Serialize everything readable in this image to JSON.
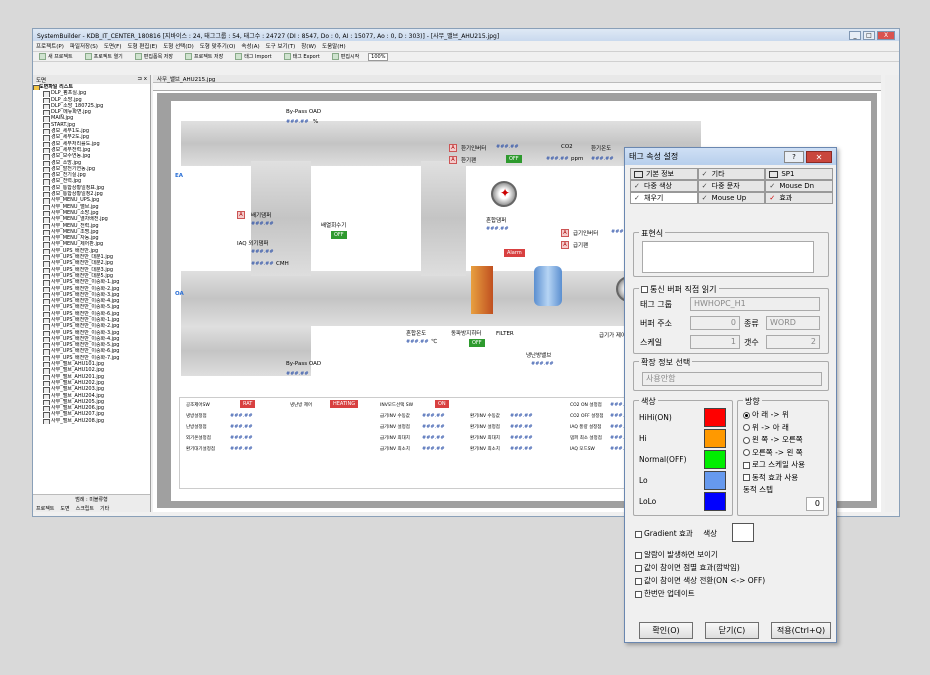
{
  "window": {
    "title": "SystemBuilder - KDB_IT_CENTER_180816 [지바이스 : 24, 태그그룹 : 54, 태그수 : 24727 (DI : 8547, Do : 0, AI : 15077, Ao : 0, D : 303)] - [사무_밸브_AHU215.jpg]",
    "min": "_",
    "max": "□",
    "close": "X"
  },
  "menu": [
    "프로젝트(P)",
    "파일저장(S)",
    "도면(F)",
    "도형 편집(E)",
    "도형 선택(D)",
    "도형 맞추기(O)",
    "속성(A)",
    "도구 보기(T)",
    "창(W)",
    "도움말(H)"
  ],
  "toolbar": [
    "새 프로젝트",
    "프로젝트 열기",
    "편집폼목 저장",
    "프로젝트 저장",
    "태그 Import",
    "태그 Export",
    "편집시작"
  ],
  "zoom": "100%",
  "tree": {
    "header": "도면",
    "pin": "⊐ x",
    "root": "도면파일 리스트",
    "items": [
      "DLP_펌프실.jpg",
      "DLP_소방.jpg",
      "DLP_소방_180725.jpg",
      "DLP_메뉴화면.jpg",
      "MAIN.jpg",
      "START.jpg",
      "경보_세부1도.jpg",
      "경보_세부2도.jpg",
      "경보_세부처리률도.jpg",
      "경보_세부전력.jpg",
      "경보_보수연동.jpg",
      "경보_소방.jpg",
      "경보_발전기연동.jpg",
      "경보_전기실.jpg",
      "경보_전력.jpg",
      "경보_통합상황일정표.jpg",
      "경보_통합상황일정2.jpg",
      "사무_MENU_UPS.jpg",
      "사무_MENU_밸브.jpg",
      "사무_MENU_소방.jpg",
      "사무_MENU_열차배전.jpg",
      "사무_MENU_전력.jpg",
      "사무_MENU_조명.jpg",
      "사무_MENU_자동.jpg",
      "사무_MENU_제어판.jpg",
      "사무_UPS_배전반.jpg",
      "사무_UPS_배전반_대분1.jpg",
      "사무_UPS_배전반_대분2.jpg",
      "사무_UPS_배전반_대분3.jpg",
      "사무_UPS_배전반_대분5.jpg",
      "사무_UPS_배전반_이중화-1.jpg",
      "사무_UPS_배전반_이중화-2.jpg",
      "사무_UPS_배전반_이중화-3.jpg",
      "사무_UPS_배전반_이중화-4.jpg",
      "사무_UPS_배전반_이중화-5.jpg",
      "사무_UPS_배전반_이중화-6.jpg",
      "사무_UPS_배전반_이중화-1.jpg",
      "사무_UPS_배전반_이중화-2.jpg",
      "사무_UPS_배전반_이중화-3.jpg",
      "사무_UPS_배전반_이중화-4.jpg",
      "사무_UPS_배전반_이중화-5.jpg",
      "사무_UPS_배전반_이중화-6.jpg",
      "사무_UPS_배전반_이중화-7.jpg",
      "사무_밸브_AHU101.jpg",
      "사무_밸브_AHU102.jpg",
      "사무_밸브_AHU201.jpg",
      "사무_밸브_AHU202.jpg",
      "사무_밸브_AHU203.jpg",
      "사무_밸브_AHU204.jpg",
      "사무_밸브_AHU205.jpg",
      "사무_밸브_AHU206.jpg",
      "사무_밸브_AHU207.jpg",
      "사무_밸브_AHU208.jpg"
    ],
    "footer_tag": "범례 : 미블류형",
    "footer_tabs": [
      "프로젝트",
      "도면",
      "스크립트",
      "기타"
    ]
  },
  "doc_tab": "사무_밸브_AHU215.jpg",
  "scada": {
    "bypass_oad_top": "By-Pass OAD",
    "bypass_val": "###.##",
    "pct": "%",
    "ea": "EA",
    "oa": "OA",
    "exhaust_damper": "배기댐퍼",
    "iaq_damper": "IAQ 외기댐퍼",
    "cmh": "CMH",
    "return_fan": "배열회수기",
    "on": "ON",
    "off": "OFF",
    "exhaust_inverter": "환기인버터",
    "exhaust_fan": "환기팬",
    "co2": "CO2",
    "ppm": "ppm",
    "return_temp": "환기온도",
    "mix_damper": "혼합댐퍼",
    "supply_inverter": "급기인버터",
    "supply_fan": "급기팬",
    "alarm": "Alarm",
    "mix_temp": "혼합온도",
    "degc": "℃",
    "freeze": "동파방지히터",
    "filter": "FILTER",
    "humid": "급기가 제어",
    "valve": "냉난방밸브",
    "bypass_oad_bot": "By-Pass OAD",
    "bottom": {
      "col1": [
        "공조제어SW",
        "냉방설정점",
        "난방설정점",
        "외기온설정점",
        "환기대기설정점"
      ],
      "rat": "RAT",
      "heat_label": "냉난방 제어",
      "heating": "HEATING",
      "col2": [
        "INV모드선택 SW",
        "급기INV 수동값",
        "급기INV 설정점",
        "급기INV 최대치",
        "급기INV 최소치"
      ],
      "col3": [
        "환기INV 수동값",
        "환기INV 설정점",
        "환기INV 최대치",
        "환기INV 최소치"
      ],
      "col4": [
        "CO2 ON 설정점",
        "CO2 OFF 설정점",
        "IAQ 풍량 설정점",
        "댐퍼 최소 설정점",
        "IAQ 모드SW"
      ]
    }
  },
  "dialog": {
    "title": "태그 속성 설정",
    "help": "?",
    "close": "✕",
    "tabs_row1": [
      "기본 정보",
      "기타",
      "SP1"
    ],
    "tabs_row2": [
      "다중 색상",
      "다중 문자",
      "Mouse Dn"
    ],
    "tabs_row3": [
      "채우기",
      "Mouse Up",
      "효과"
    ],
    "expr_label": "표현식",
    "comm_label": "통신 버퍼 직접 읽기",
    "tag_group_label": "태그 그룹",
    "tag_group_value": "HWHOPC_H1",
    "buffer_addr_label": "버퍼 주소",
    "buffer_addr_value": "0",
    "type_label": "종류",
    "type_value": "WORD",
    "scale_label": "스케일",
    "scale_value": "1",
    "count_label": "갯수",
    "count_value": "2",
    "ext_label": "확장 정보 선택",
    "ext_value": "사용안함",
    "color_label": "색상",
    "colors": [
      {
        "name": "HiHi(ON)",
        "hex": "#ff0000"
      },
      {
        "name": "Hi",
        "hex": "#ff9900"
      },
      {
        "name": "Normal(OFF)",
        "hex": "#00ee00"
      },
      {
        "name": "Lo",
        "hex": "#6699ee"
      },
      {
        "name": "LoLo",
        "hex": "#0000ff"
      }
    ],
    "dir_label": "방향",
    "directions": [
      "아 래 -> 위",
      "위 -> 아 래",
      "왼 쪽 -> 오른쪽",
      "오른쪽 -> 왼 쪽"
    ],
    "log_scale": "로그 스케일 사용",
    "anim": "동적 효과 사용",
    "step_label": "동적 스텝",
    "step_value": "0",
    "gradient": "Gradient 효과",
    "gradient_color": "색상",
    "opts": [
      "알람이 발생하면 보이기",
      "값이 참이면 점멸 효과(깜박임)",
      "값이 참이면 색상 전환(ON <-> OFF)",
      "한번만 업데이트"
    ],
    "ok": "확인(O)",
    "cancel": "닫기(C)",
    "apply": "적용(Ctrl+Q)"
  }
}
